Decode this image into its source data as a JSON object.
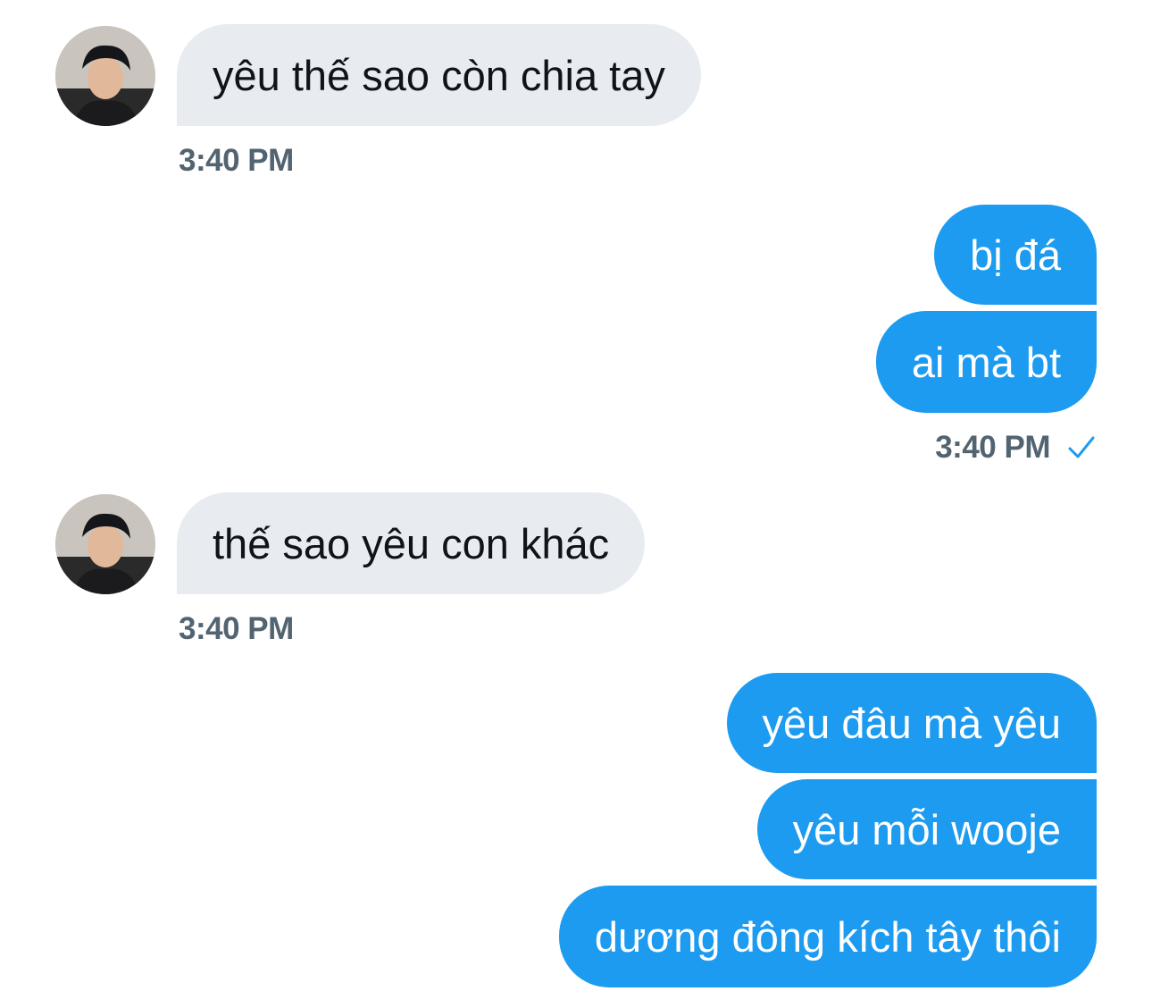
{
  "messages": [
    {
      "direction": "in",
      "text": "yêu thế sao còn chia tay"
    },
    {
      "direction": "in",
      "time": "3:40 PM"
    },
    {
      "direction": "out",
      "text": "bị đá"
    },
    {
      "direction": "out",
      "text": "ai mà bt"
    },
    {
      "direction": "out",
      "time": "3:40 PM",
      "status_icon": "check-icon"
    },
    {
      "direction": "in",
      "text": "thế sao yêu con khác"
    },
    {
      "direction": "in",
      "time": "3:40 PM"
    },
    {
      "direction": "out",
      "text": "yêu đâu mà yêu"
    },
    {
      "direction": "out",
      "text": "yêu mỗi wooje"
    },
    {
      "direction": "out",
      "text": "dương đông kích tây thôi"
    }
  ],
  "colors": {
    "outgoing_bubble": "#1d9bf0",
    "incoming_bubble": "#e8ecf1",
    "timestamp": "#536471",
    "check": "#1d9bf0"
  }
}
